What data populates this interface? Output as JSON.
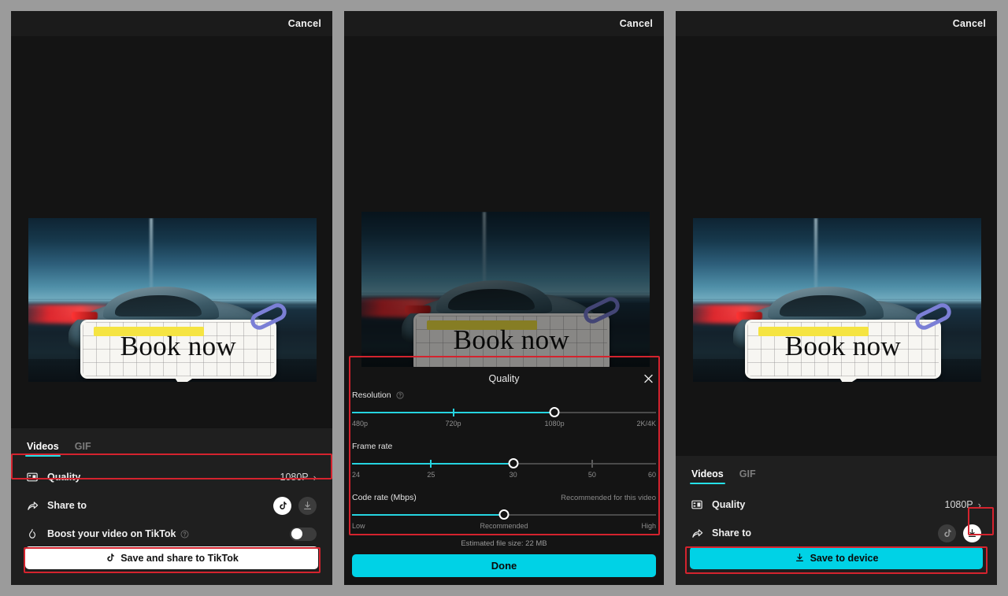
{
  "panels": {
    "left": {
      "cancel_label": "Cancel",
      "tabs": [
        {
          "label": "Videos",
          "active": true
        },
        {
          "label": "GIF",
          "active": false
        }
      ],
      "rows": {
        "quality": {
          "label": "Quality",
          "value": "1080P",
          "icon": "film-frame-icon",
          "chevron": "›"
        },
        "share": {
          "label": "Share to",
          "icon": "share-arrow-icon",
          "targets": [
            "tiktok-icon",
            "download-icon"
          ]
        },
        "boost": {
          "label": "Boost your video on TikTok",
          "icon": "flame-icon",
          "help": "help-icon",
          "toggle_on": false
        }
      },
      "cta": {
        "label": "Save and share to TikTok",
        "icon": "tiktok-note-icon",
        "style": "light"
      }
    },
    "middle": {
      "cancel_label": "Cancel",
      "dialog": {
        "title": "Quality",
        "close_icon": "close-icon",
        "sliders": [
          {
            "name": "resolution",
            "label": "Resolution",
            "help": "help-icon",
            "hint": "",
            "ticks": [
              "480p",
              "720p",
              "1080p",
              "2K/4K"
            ],
            "value_index": 2,
            "fill_pct": 66.6,
            "tick_positions": [
              0,
              33.3,
              66.6,
              100
            ]
          },
          {
            "name": "frame-rate",
            "label": "Frame rate",
            "help": "",
            "hint": "",
            "ticks": [
              "24",
              "25",
              "30",
              "50",
              "60"
            ],
            "value_index": 2,
            "fill_pct": 53,
            "tick_positions": [
              0,
              26,
              53,
              79,
              100
            ]
          },
          {
            "name": "code-rate",
            "label": "Code rate (Mbps)",
            "help": "",
            "hint": "Recommended for this video",
            "ticks": [
              "Low",
              "Recommended",
              "High"
            ],
            "value_index": 1,
            "fill_pct": 50,
            "tick_positions": [
              0,
              50,
              100
            ]
          }
        ],
        "file_size": "Estimated file size: 22 MB",
        "done_label": "Done"
      }
    },
    "right": {
      "cancel_label": "Cancel",
      "tabs": [
        {
          "label": "Videos",
          "active": true
        },
        {
          "label": "GIF",
          "active": false
        }
      ],
      "rows": {
        "quality": {
          "label": "Quality",
          "value": "1080P",
          "icon": "film-frame-icon",
          "chevron": "›"
        },
        "share": {
          "label": "Share to",
          "icon": "share-arrow-icon",
          "targets": [
            "tiktok-icon",
            "download-icon"
          ]
        }
      },
      "cta": {
        "label": "Save to device",
        "icon": "download-icon",
        "style": "cyan"
      }
    }
  },
  "thumbnail": {
    "sticker_text": "Book now",
    "alt": "car driving with motion blur and red light trail"
  },
  "colors": {
    "accent_cyan": "#00d2e6",
    "slider_cyan": "#25d4e0",
    "highlight_red": "#d4232e",
    "panel_bg": "#1b1b1b",
    "sheet_bg": "#1f1f1f",
    "dialog_bg": "#141414",
    "page_bg": "#9b9b9b"
  }
}
